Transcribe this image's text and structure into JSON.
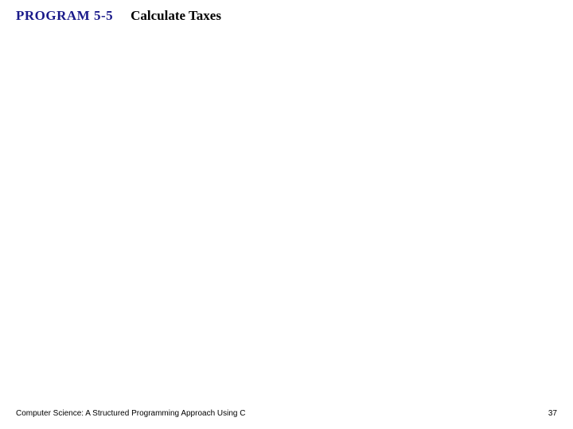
{
  "header": {
    "program_label": "PROGRAM 5-5",
    "program_title": "Calculate Taxes"
  },
  "footer": {
    "text": "Computer Science: A Structured Programming Approach Using C",
    "page_number": "37"
  }
}
